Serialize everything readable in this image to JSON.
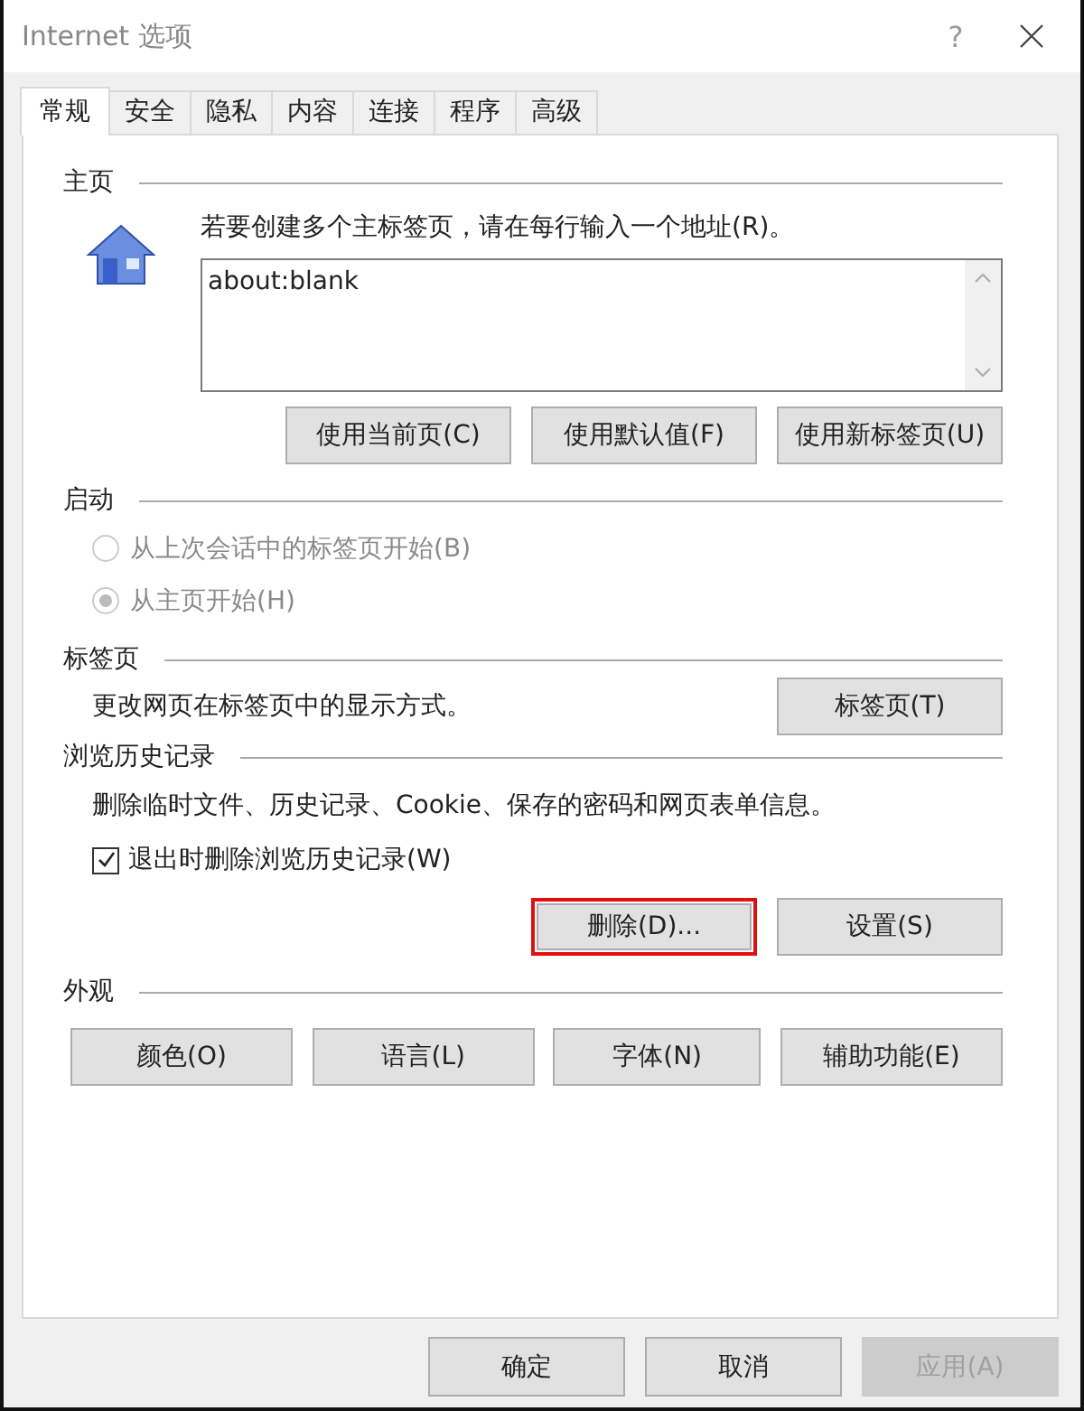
{
  "window": {
    "title": "Internet 选项",
    "help": "?"
  },
  "tabs": [
    {
      "label": "常规",
      "selected": true
    },
    {
      "label": "安全",
      "selected": false
    },
    {
      "label": "隐私",
      "selected": false
    },
    {
      "label": "内容",
      "selected": false
    },
    {
      "label": "连接",
      "selected": false
    },
    {
      "label": "程序",
      "selected": false
    },
    {
      "label": "高级",
      "selected": false
    }
  ],
  "homepage": {
    "heading": "主页",
    "instruction": "若要创建多个主标签页，请在每行输入一个地址(R)。",
    "addresses": "about:blank",
    "buttons": [
      "使用当前页(C)",
      "使用默认值(F)",
      "使用新标签页(U)"
    ]
  },
  "startup": {
    "heading": "启动",
    "options": [
      {
        "label": "从上次会话中的标签页开始(B)",
        "selected": false,
        "disabled": true
      },
      {
        "label": "从主页开始(H)",
        "selected": true,
        "disabled": true
      }
    ]
  },
  "tabs_section": {
    "heading": "标签页",
    "description": "更改网页在标签页中的显示方式。",
    "button": "标签页(T)"
  },
  "history": {
    "heading": "浏览历史记录",
    "description": "删除临时文件、历史记录、Cookie、保存的密码和网页表单信息。",
    "checkbox": {
      "label": "退出时删除浏览历史记录(W)",
      "checked": true
    },
    "buttons": [
      {
        "label": "删除(D)...",
        "highlighted": true
      },
      {
        "label": "设置(S)",
        "highlighted": false
      }
    ]
  },
  "appearance": {
    "heading": "外观",
    "buttons": [
      "颜色(O)",
      "语言(L)",
      "字体(N)",
      "辅助功能(E)"
    ]
  },
  "footer_buttons": [
    {
      "label": "确定",
      "disabled": false
    },
    {
      "label": "取消",
      "disabled": false
    },
    {
      "label": "应用(A)",
      "disabled": true
    }
  ]
}
